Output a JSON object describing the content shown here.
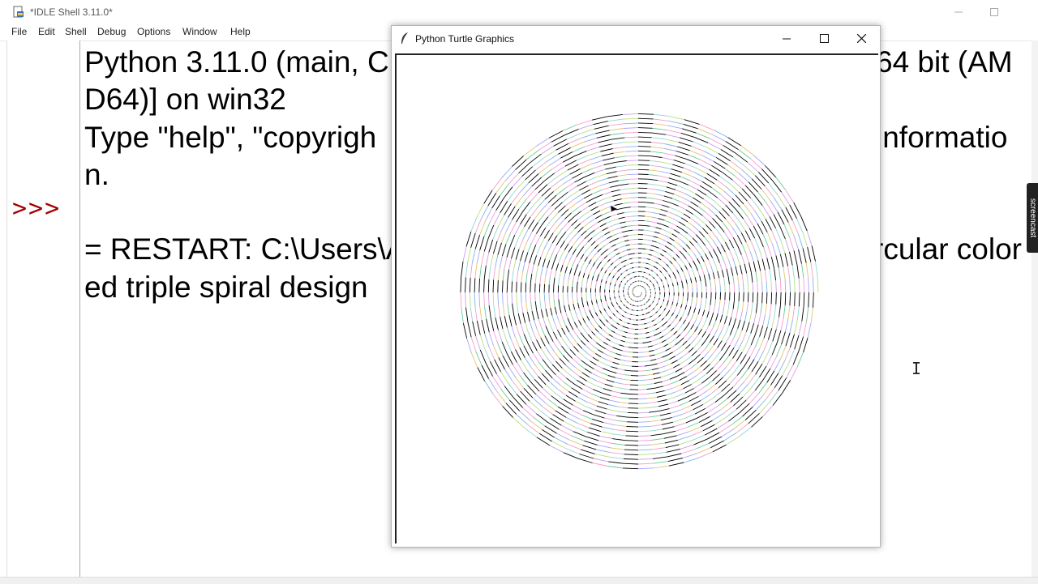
{
  "idle": {
    "title": "*IDLE Shell 3.11.0*",
    "menu": [
      "File",
      "Edit",
      "Shell",
      "Debug",
      "Options",
      "Window",
      "Help"
    ],
    "prompt": ">>>",
    "lines": [
      "Python 3.11.0 (main, C",
      "D64)] on win32",
      "Type \"help\", \"copyrigh",
      "n.",
      "",
      "= RESTART: C:\\Users\\A",
      "ed triple spiral design"
    ],
    "lines_right": [
      "64 bit (AM",
      "",
      "informatio",
      "",
      "",
      "rcular color",
      ""
    ]
  },
  "turtle_window": {
    "title": "Python Turtle Graphics"
  },
  "recorder": {
    "label": "screencast"
  },
  "spiral": {
    "colors": [
      "#000000",
      "#c9a0e8",
      "#8fd6d6",
      "#b8e07a",
      "#f0a0c8",
      "#7fb3e6",
      "#e6c46f",
      "#a4a4ff",
      "#66cc99",
      "#ff99cc"
    ]
  }
}
